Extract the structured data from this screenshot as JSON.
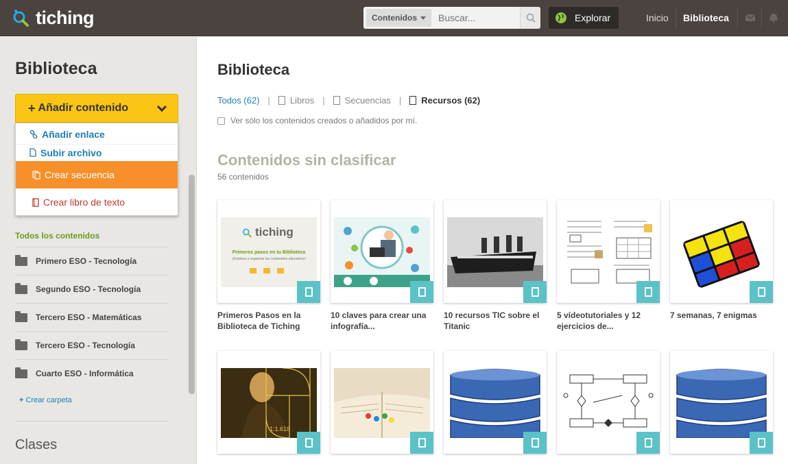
{
  "header": {
    "logo_text": "tiching",
    "search_category": "Contenidos",
    "search_placeholder": "Buscar...",
    "explore_label": "Explorar",
    "nav_home": "Inicio",
    "nav_library": "Biblioteca"
  },
  "sidebar": {
    "title": "Biblioteca",
    "add_button": "Añadir contenido",
    "dropdown": {
      "add_link": "Añadir enlace",
      "upload_file": "Subir archivo",
      "create_sequence": "Crear secuencia",
      "create_textbook": "Crear libro de texto"
    },
    "all_contents": "Todos los contenidos",
    "folders": [
      "Primero ESO - Tecnología",
      "Segundo ESO - Tecnología",
      "Tercero ESO - Matemáticas",
      "Tercero ESO - Tecnología",
      "Cuarto ESO - Informática"
    ],
    "create_folder": "Crear carpeta",
    "classes_title": "Clases"
  },
  "main": {
    "title": "Biblioteca",
    "filters": {
      "all": "Todos (62)",
      "books": "Libros",
      "sequences": "Secuencias",
      "resources": "Recursos (62)"
    },
    "only_mine": "Ver sólo los contenidos creados o añadidos por mí.",
    "section_title": "Contenidos sin clasificar",
    "section_count": "56 contenidos",
    "cards": [
      {
        "title": "Primeros Pasos en la Biblioteca de Tiching",
        "thumb_logo": "tiching",
        "thumb_title": "Primeros pasos en tu Biblioteca",
        "thumb_sub": "¡Empieza a organizar tus contenidos educativos!"
      },
      {
        "title": "10 claves para crear una infografía..."
      },
      {
        "title": "10 recursos TIC sobre el Titanic"
      },
      {
        "title": "5 vídeotutoriales y 12 ejercicios de..."
      },
      {
        "title": "7 semanas, 7 enigmas"
      },
      {
        "title": "",
        "thumb_label": "1:1.618"
      },
      {
        "title": ""
      },
      {
        "title": ""
      },
      {
        "title": ""
      },
      {
        "title": ""
      }
    ]
  },
  "colors": {
    "topbar": "#4a4340",
    "accent_blue": "#1d7fb5",
    "add_yellow": "#fac515",
    "sequence_orange": "#f7902a",
    "badge_teal": "#5bc2c8",
    "folder_green": "#6e9a1c"
  }
}
